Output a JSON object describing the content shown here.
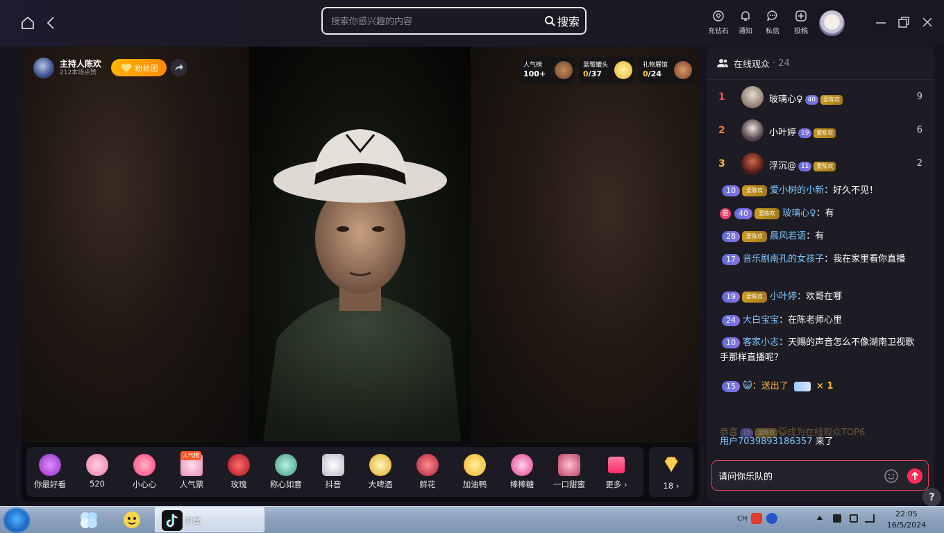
{
  "header": {
    "search_placeholder": "搜索你感兴趣的内容",
    "search_button": "搜索",
    "nav": [
      {
        "label": "充钻石",
        "icon": "diamond-icon"
      },
      {
        "label": "通知",
        "icon": "bell-icon"
      },
      {
        "label": "私信",
        "icon": "message-icon"
      },
      {
        "label": "投稿",
        "icon": "upload-icon"
      }
    ]
  },
  "stream": {
    "host_name": "主持人陈欢",
    "host_likes": "212本场点赞",
    "fan_club_label": "粉丝团",
    "badges": [
      {
        "label": "人气榜",
        "value": "100+"
      },
      {
        "label": "蓝莓罐头",
        "value": "0",
        "total": "/37"
      },
      {
        "label": "礼物展馆",
        "value": "0",
        "total": "/24"
      }
    ]
  },
  "gifts": [
    {
      "name": "你最好看",
      "color": "#b04bd8"
    },
    {
      "name": "520",
      "color": "#f48ab0"
    },
    {
      "name": "小心心",
      "color": "#ff5c8e"
    },
    {
      "name": "人气票",
      "color": "#f2a3c4",
      "tag": "人气榜"
    },
    {
      "name": "玫瑰",
      "color": "#e0303a"
    },
    {
      "name": "称心如意",
      "color": "#5fc3a8"
    },
    {
      "name": "抖音",
      "color": "#e8e8ee"
    },
    {
      "name": "大啤酒",
      "color": "#f2c94c"
    },
    {
      "name": "鲜花",
      "color": "#d83b4f"
    },
    {
      "name": "加油鸭",
      "color": "#f7c531"
    },
    {
      "name": "棒棒糖",
      "color": "#f25ca0"
    },
    {
      "name": "一口甜蜜",
      "color": "#e86a8e"
    },
    {
      "name": "更多 ›",
      "color": "#ff4d7d"
    }
  ],
  "diamond": {
    "count": "18 ›"
  },
  "audience": {
    "title": "在线观众",
    "count": "· 24",
    "top": [
      {
        "rank": "1",
        "name": "玻璃心♀",
        "level": "40",
        "fan": "爱陈欢",
        "score": "9",
        "rank_color": "#ff4a57"
      },
      {
        "rank": "2",
        "name": "小叶婷",
        "level": "19",
        "fan": "爱陈欢",
        "score": "6",
        "rank_color": "#ff7a3d"
      },
      {
        "rank": "3",
        "name": "浮沉@",
        "level": "11",
        "fan": "爱陈欢",
        "score": "2",
        "rank_color": "#ffb938"
      }
    ]
  },
  "chat": [
    {
      "level": "10",
      "fan": "爱陈欢",
      "user": "爱小树的小新",
      "text": "：好久不见！"
    },
    {
      "guan": "管",
      "level": "40",
      "fan": "爱陈欢",
      "user": "玻璃心♀",
      "text": "：有"
    },
    {
      "level": "28",
      "fan": "爱陈欢",
      "user": "晨风若语",
      "text": "：有"
    },
    {
      "level": "17",
      "user": "音乐剧南孔的女孩子",
      "text": "：我在家里看你直播"
    },
    {
      "level": "19",
      "fan": "爱陈欢",
      "user": "小叶婷",
      "text": "：欢哥在哪"
    },
    {
      "level": "24",
      "user": "大白宝宝",
      "text": "：在陈老师心里"
    },
    {
      "level": "10",
      "user": "客家小志",
      "text": "：天赐的声音怎么不像湖南卫视歌手那样直播呢？"
    },
    {
      "level": "15",
      "user": "😺",
      "gift_text": "：送出了",
      "gift_count": "× 1"
    }
  ],
  "system": {
    "prefix": "恭喜",
    "level": "15",
    "fan": "爱陈欢",
    "suffix": "😺成为在线观众TOP6"
  },
  "enter": {
    "user": "用户7039893186357",
    "text": " 来了"
  },
  "input": {
    "value": "请问你乐队的"
  },
  "help": "?",
  "taskbar": {
    "app_label": "抖音",
    "lang": "CH",
    "time": "22:05",
    "date": "16/5/2024"
  }
}
